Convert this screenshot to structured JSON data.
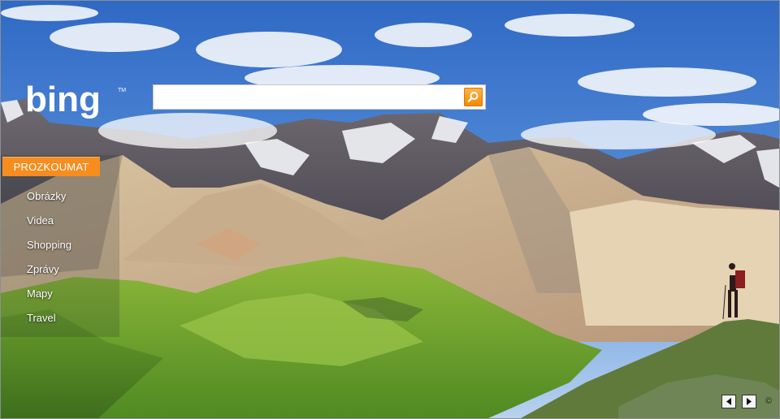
{
  "logo": {
    "text": "bing",
    "mark": "TM"
  },
  "search": {
    "value": "",
    "placeholder": "",
    "button_icon": "search-icon",
    "accent": "#f68d1e"
  },
  "nav": {
    "header": "PROZKOUMAT",
    "items": [
      {
        "label": "Obrázky"
      },
      {
        "label": "Videa"
      },
      {
        "label": "Shopping"
      },
      {
        "label": "Zprávy"
      },
      {
        "label": "Mapy"
      },
      {
        "label": "Travel"
      }
    ]
  },
  "footer": {
    "prev_icon": "previous-image-icon",
    "next_icon": "next-image-icon",
    "copyright_symbol": "©"
  }
}
